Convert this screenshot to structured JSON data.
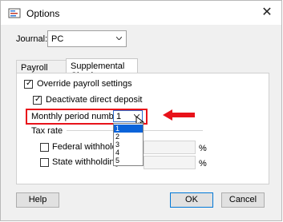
{
  "window": {
    "title": "Options",
    "app_icon": "options-icon",
    "close_glyph": "✕"
  },
  "journal": {
    "label": "Journal:",
    "value": "PC"
  },
  "tabs": [
    {
      "label": "Payroll Checks",
      "active": false
    },
    {
      "label": "Supplemental Checks",
      "active": true
    }
  ],
  "panel": {
    "override": {
      "label": "Override payroll settings",
      "checked": true
    },
    "deactivate": {
      "label": "Deactivate direct deposit",
      "checked": true
    },
    "monthly_period": {
      "label": "Monthly period number:",
      "value": "1",
      "options": [
        "1",
        "2",
        "3",
        "4",
        "5"
      ],
      "selected_index": 0
    },
    "tax_rate": {
      "label": "Tax rate"
    },
    "federal": {
      "label": "Federal withholding",
      "checked": false,
      "value": "",
      "unit": "%"
    },
    "state": {
      "label": "State withholding ra",
      "checked": false,
      "value": "",
      "unit": "%"
    }
  },
  "buttons": {
    "help": "Help",
    "ok": "OK",
    "cancel": "Cancel"
  },
  "colors": {
    "highlight_box": "#e8121a",
    "arrow": "#e8121a",
    "selection": "#0a63d9"
  }
}
